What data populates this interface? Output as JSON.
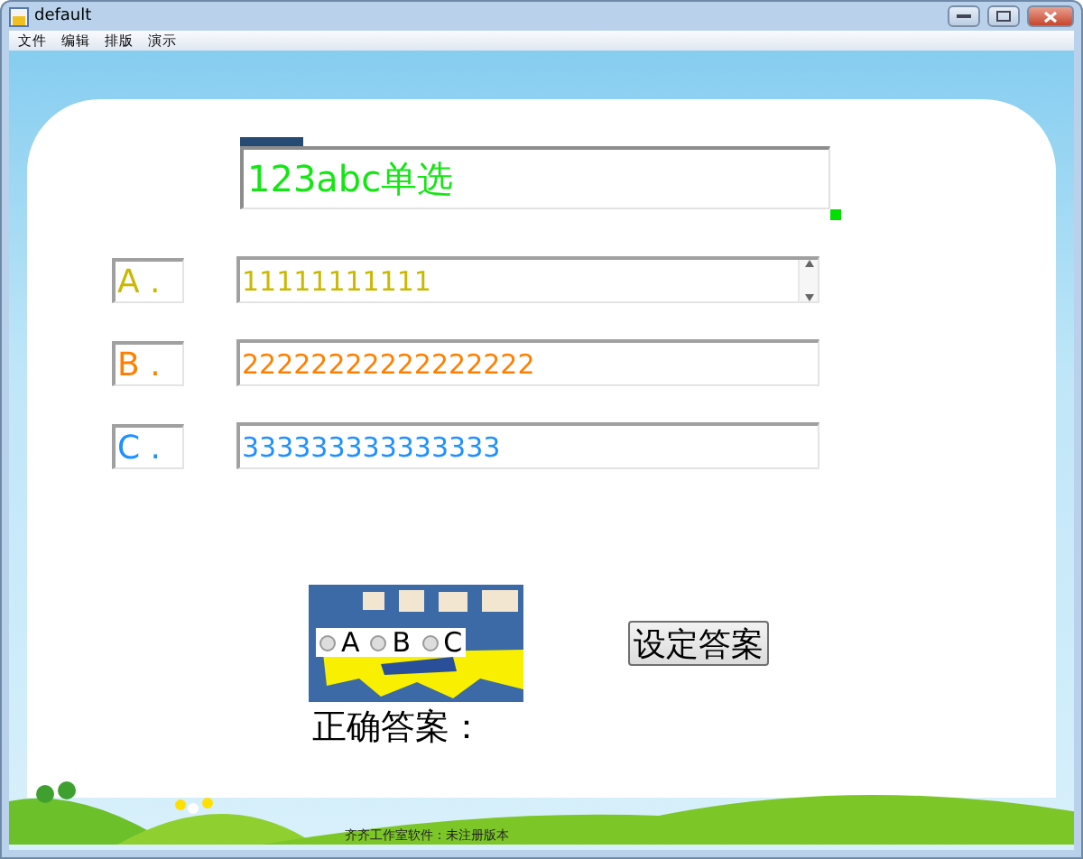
{
  "window": {
    "title": "default"
  },
  "menu": [
    "文件",
    "编辑",
    "排版",
    "演示"
  ],
  "question": {
    "value": "123abc单选"
  },
  "options": [
    {
      "label": "A .",
      "value": "11111111111",
      "color": "#c9b900",
      "kind": "scrolling"
    },
    {
      "label": "B .",
      "value": "22222222222222222",
      "color": "#ff8000",
      "kind": "plain"
    },
    {
      "label": "C .",
      "value": "333333333333333",
      "color": "#1e90ff",
      "kind": "plain"
    }
  ],
  "answer_choices": [
    {
      "label": "A",
      "selected": false
    },
    {
      "label": "B",
      "selected": false
    },
    {
      "label": "C",
      "selected": false
    }
  ],
  "set_button": "设定答案",
  "correct_answer_label": "正确答案：",
  "footer": "齐齐工作室软件：未注册版本"
}
